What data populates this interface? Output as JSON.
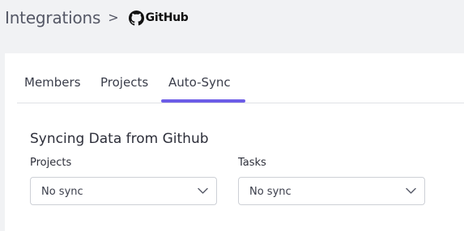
{
  "breadcrumb": {
    "root": "Integrations",
    "separator": ">",
    "current": "GitHub"
  },
  "icons": {
    "github": "github-icon",
    "chevron": "chevron-down-icon"
  },
  "tabs": [
    {
      "label": "Members",
      "active": false
    },
    {
      "label": "Projects",
      "active": false
    },
    {
      "label": "Auto-Sync",
      "active": true
    }
  ],
  "section": {
    "title": "Syncing Data from Github"
  },
  "fields": {
    "projects": {
      "label": "Projects",
      "value": "No sync"
    },
    "tasks": {
      "label": "Tasks",
      "value": "No sync"
    }
  },
  "colors": {
    "accent": "#6c5ce7",
    "background": "#f1f2f4"
  }
}
